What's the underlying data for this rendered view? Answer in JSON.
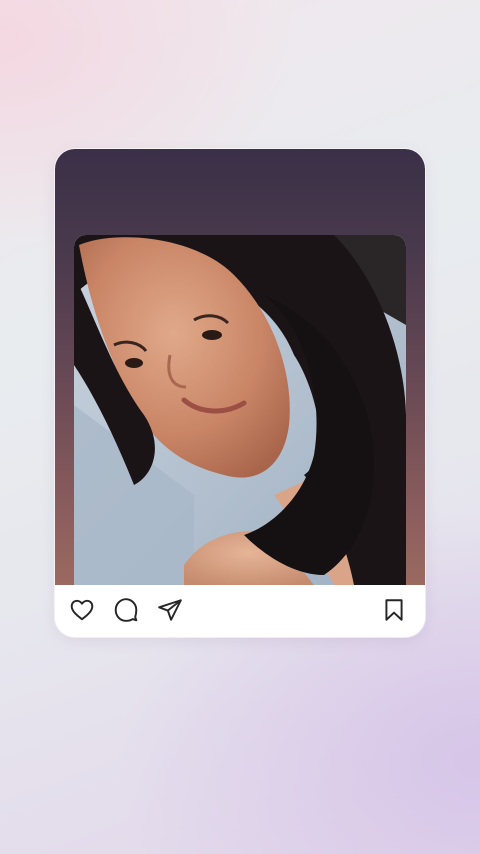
{
  "post": {
    "photo_description_icon": "portrait-photo",
    "actions": {
      "like_icon": "heart-icon",
      "comment_icon": "speech-bubble-icon",
      "share_icon": "paper-plane-icon",
      "save_icon": "bookmark-icon"
    }
  },
  "colors": {
    "frame_gradient_top": "#3a3047",
    "frame_gradient_bottom": "#9a6a60",
    "card_background": "#ffffff",
    "icon_stroke": "#262626"
  }
}
